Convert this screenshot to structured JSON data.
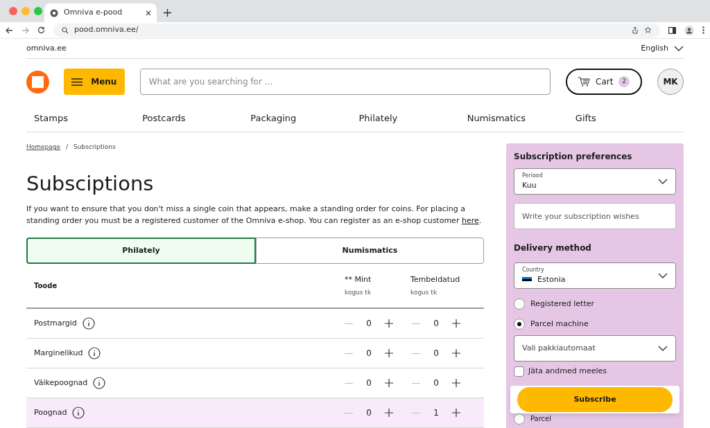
{
  "browser": {
    "tab_title": "Omniva e-pood",
    "url": "pood.omniva.ee/"
  },
  "topbar": {
    "site_link": "omniva.ee",
    "language": "English"
  },
  "header": {
    "menu_label": "Menu",
    "search": {
      "placeholder": "What are you searching for ..."
    },
    "cart": {
      "label": "Cart",
      "count": "2"
    },
    "avatar": "MK"
  },
  "nav": [
    "Stamps",
    "Postcards",
    "Packaging",
    "Philately",
    "Numismatics",
    "Gifts"
  ],
  "breadcrumb": [
    "Homepage",
    "/",
    "Subscriptions"
  ],
  "title": "Subsciptions",
  "intro": {
    "text": "If you want to ensure that you don't miss a single coin that appears, make a standing order for coins. For placing a standing order you must be a registered customer of the Omniva e-shop. You can register as an e-shop customer ",
    "link": "here",
    "end": "."
  },
  "tabs": [
    {
      "label": "Philately",
      "selected": true
    },
    {
      "label": "Numismatics",
      "selected": false
    }
  ],
  "table": {
    "columns": [
      {
        "title": "Toode"
      },
      {
        "title": "** Mint",
        "unit": "kogus tk"
      },
      {
        "title": "Tembeldatud",
        "unit": "kogus tk"
      }
    ],
    "rows": [
      {
        "name": "Postmargid",
        "highlighted": false,
        "mint": "0",
        "stamped": "0"
      },
      {
        "name": "Marginelikud",
        "highlighted": false,
        "mint": "0",
        "stamped": "0"
      },
      {
        "name": "Väikepoognad",
        "highlighted": false,
        "mint": "0",
        "stamped": "0"
      },
      {
        "name": "Poognad",
        "highlighted": true,
        "mint": "0",
        "stamped": "1"
      }
    ]
  },
  "sidebar": {
    "title": "Subscription preferences",
    "period": {
      "label": "Periood",
      "value": "Kuu"
    },
    "wishes": {
      "placeholder": "Write your subscription wishes"
    },
    "delivery_title": "Delivery method",
    "country": {
      "label": "Country",
      "value": "Estonia"
    },
    "methods": [
      {
        "label": "Registered letter",
        "selected": false
      },
      {
        "label": "Parcel machine",
        "selected": true
      }
    ],
    "parcel_machine": {
      "placeholder": "Vali pakkiautomaat"
    },
    "remember": {
      "label": "Jäta andmed meeles",
      "checked": false
    },
    "method_below": {
      "label": "Parcel",
      "selected": false
    },
    "subscribe": "Subscribe"
  }
}
